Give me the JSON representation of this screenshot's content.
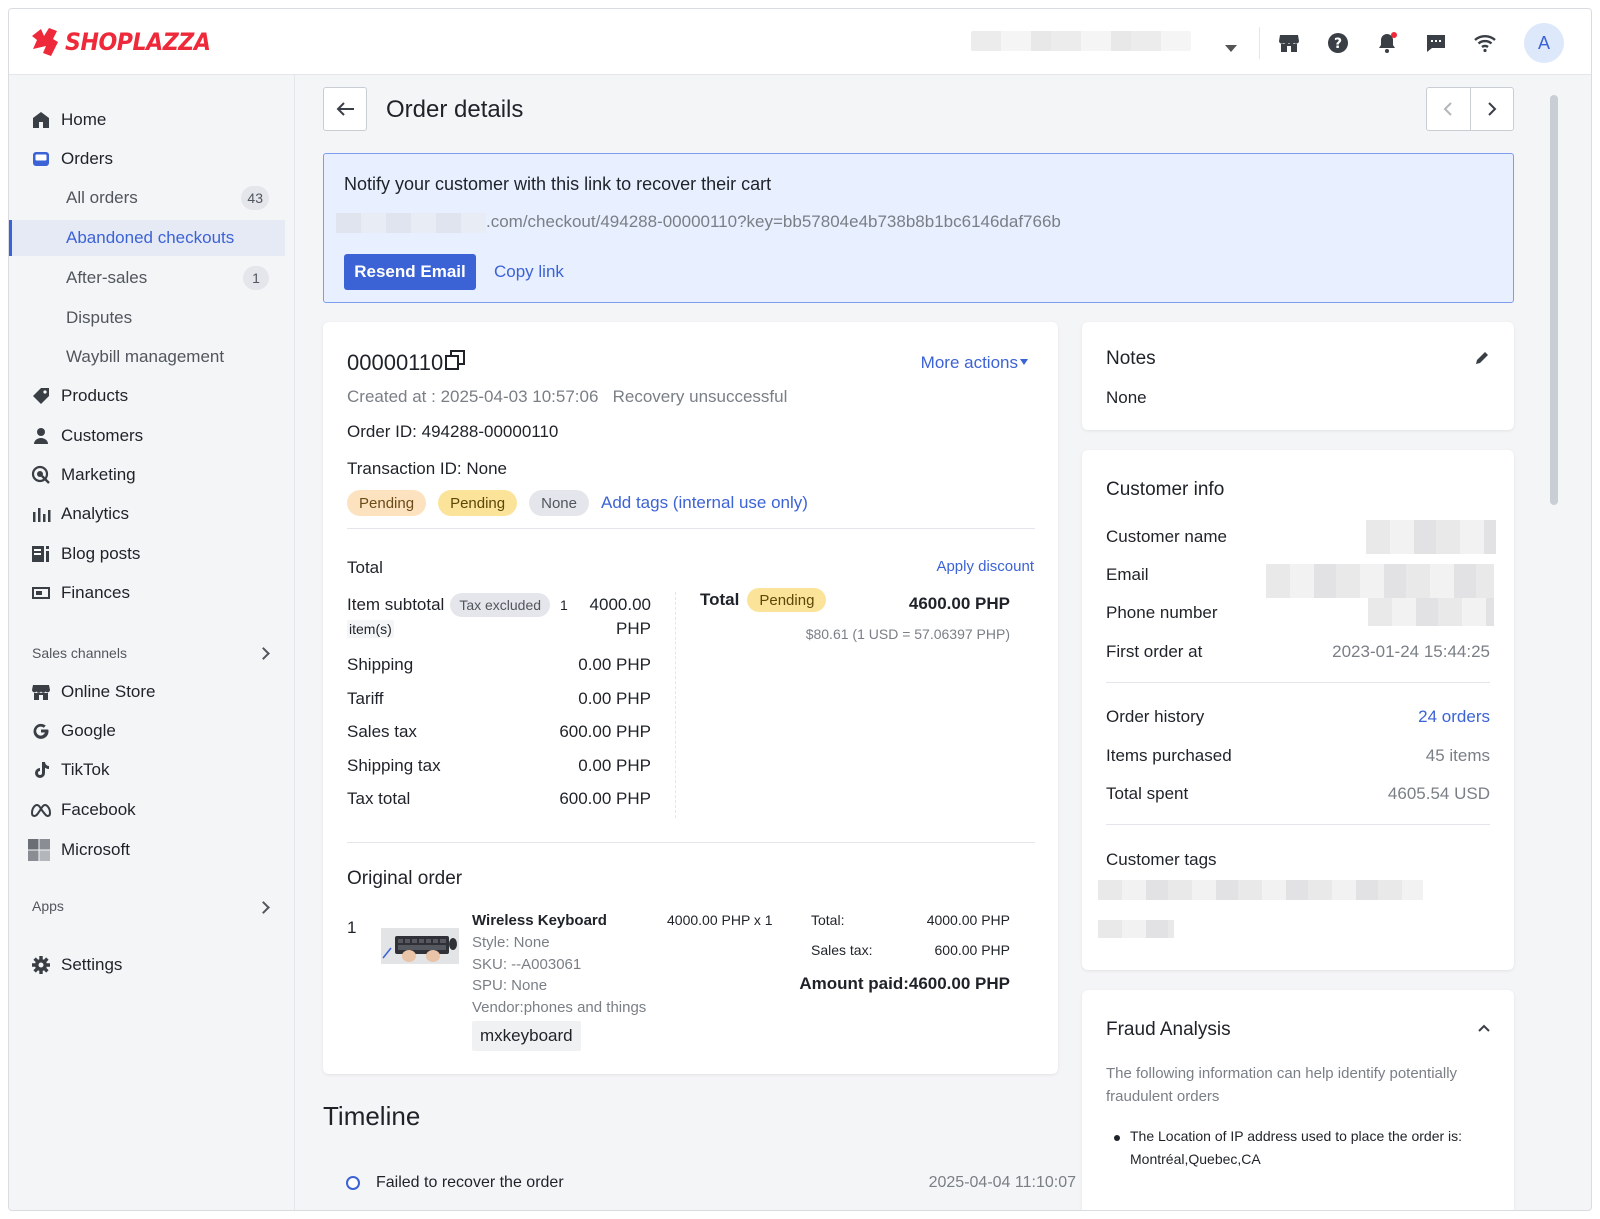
{
  "brand": {
    "name": "SHOPLAZZA",
    "color": "#ee2a3a"
  },
  "topbar": {
    "avatar_initial": "A",
    "icons": [
      "store-icon",
      "help-icon",
      "bell-icon",
      "chat-icon",
      "wifi-icon"
    ]
  },
  "sidebar": {
    "items": [
      {
        "label": "Home",
        "icon": "home-icon"
      },
      {
        "label": "Orders",
        "icon": "orders-icon"
      },
      {
        "label": "Products",
        "icon": "tag-icon"
      },
      {
        "label": "Customers",
        "icon": "person-icon"
      },
      {
        "label": "Marketing",
        "icon": "marketing-icon"
      },
      {
        "label": "Analytics",
        "icon": "bar-chart-icon"
      },
      {
        "label": "Blog posts",
        "icon": "blog-icon"
      },
      {
        "label": "Finances",
        "icon": "finance-icon"
      }
    ],
    "order_sub": [
      {
        "label": "All orders",
        "badge": "43"
      },
      {
        "label": "Abandoned checkouts",
        "badge": ""
      },
      {
        "label": "After-sales",
        "badge": "1"
      },
      {
        "label": "Disputes",
        "badge": ""
      },
      {
        "label": "Waybill management",
        "badge": ""
      }
    ],
    "sales_channels_heading": "Sales channels",
    "channels": [
      {
        "label": "Online Store",
        "icon": "store-icon"
      },
      {
        "label": "Google",
        "icon": "google-icon"
      },
      {
        "label": "TikTok",
        "icon": "tiktok-icon"
      },
      {
        "label": "Facebook",
        "icon": "meta-icon"
      },
      {
        "label": "Microsoft",
        "icon": "microsoft-icon"
      }
    ],
    "apps_heading": "Apps",
    "settings": "Settings",
    "accent": "#3c63d6"
  },
  "header": {
    "title": "Order details"
  },
  "banner": {
    "title": "Notify your customer with this link to recover their cart",
    "link": ".com/checkout/494288-00000110?key=bb57804e4b738b8b1bc6146daf766b",
    "resend": "Resend Email",
    "copy": "Copy link"
  },
  "order": {
    "number": "00000110",
    "more_actions": "More actions",
    "created_label": "Created at :",
    "created_at": "2025-04-03 10:57:06",
    "recovery": "Recovery unsuccessful",
    "order_id": "Order ID: 494288-00000110",
    "transaction_id": "Transaction ID: None",
    "tags": [
      "Pending",
      "Pending",
      "None"
    ],
    "add_tags": "Add tags (internal use only)"
  },
  "totals": {
    "heading": "Total",
    "apply_discount": "Apply discount",
    "subtotal_label": "Item subtotal",
    "tax_excluded": "Tax excluded",
    "items_count": "1",
    "items_unit": "item(s)",
    "subtotal_value": "4000.00",
    "subtotal_currency": "PHP",
    "rows": [
      {
        "label": "Shipping",
        "value": "0.00 PHP"
      },
      {
        "label": "Tariff",
        "value": "0.00 PHP"
      },
      {
        "label": "Sales tax",
        "value": "600.00 PHP"
      },
      {
        "label": "Shipping tax",
        "value": "0.00 PHP"
      },
      {
        "label": "Tax total",
        "value": "600.00 PHP"
      }
    ],
    "total_label": "Total",
    "total_status": "Pending",
    "total_value": "4600.00 PHP",
    "conversion": "$80.61  (1 USD = 57.06397 PHP)"
  },
  "original_order": {
    "heading": "Original order",
    "index": "1",
    "name": "Wireless Keyboard",
    "style": "Style: None",
    "sku": "SKU: --A003061",
    "spu": "SPU: None",
    "vendor": "Vendor:phones and things",
    "chip": "mxkeyboard",
    "price_qty": "4000.00 PHP x 1",
    "total_label": "Total:",
    "total_value": "4000.00 PHP",
    "tax_label": "Sales tax:",
    "tax_value": "600.00 PHP",
    "paid": "Amount paid:4600.00 PHP"
  },
  "timeline": {
    "heading": "Timeline",
    "first_event": "Failed to recover the order",
    "first_time": "2025-04-04 11:10:07"
  },
  "notes": {
    "heading": "Notes",
    "value": "None"
  },
  "customer": {
    "heading": "Customer info",
    "name_label": "Customer name",
    "email_label": "Email",
    "phone_label": "Phone number",
    "first_order_label": "First order at",
    "first_order_value": "2023-01-24 15:44:25",
    "history_label": "Order history",
    "history_value": "24 orders",
    "items_label": "Items purchased",
    "items_value": "45 items",
    "spent_label": "Total spent",
    "spent_value": "4605.54 USD",
    "tags_label": "Customer tags"
  },
  "fraud": {
    "heading": "Fraud Analysis",
    "desc": "The following information can help identify potentially fraudulent orders",
    "bullet": "The Location of IP address used to place the order is:",
    "location": "Montréal,Quebec,CA"
  }
}
